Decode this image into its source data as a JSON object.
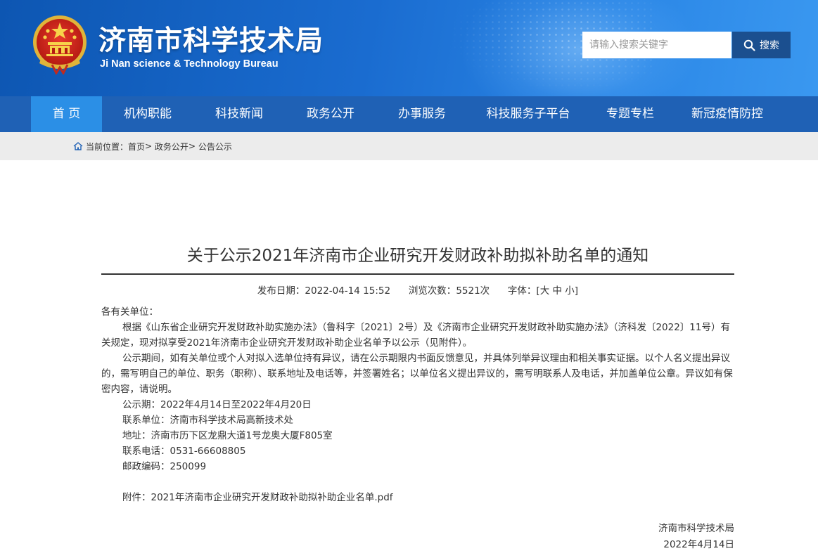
{
  "header": {
    "title": "济南市科学技术局",
    "subtitle": "Ji Nan science & Technology Bureau",
    "search": {
      "placeholder": "请输入搜索关键字",
      "button_label": "搜索"
    }
  },
  "nav": {
    "items": [
      "首 页",
      "机构职能",
      "科技新闻",
      "政务公开",
      "办事服务",
      "科技服务子平台",
      "专题专栏",
      "新冠疫情防控"
    ],
    "active_index": 0
  },
  "breadcrumb": {
    "prefix": "当前位置：",
    "items": [
      "首页",
      "政务公开",
      "公告公示"
    ],
    "separator": ">"
  },
  "article": {
    "title": "关于公示2021年济南市企业研究开发财政补助拟补助名单的通知",
    "meta": {
      "date_label": "发布日期：",
      "date": "2022-04-14 15:52",
      "views_label": "浏览次数：",
      "views": "5521次",
      "fontsize_label": "字体：",
      "fontsize_open": "[",
      "fontsize_large": "大",
      "fontsize_medium": "中",
      "fontsize_small": "小",
      "fontsize_close": "]"
    },
    "salutation": "各有关单位：",
    "paragraphs": [
      "根据《山东省企业研究开发财政补助实施办法》（鲁科字〔2021〕2号）及《济南市企业研究开发财政补助实施办法》（济科发〔2022〕11号）有关规定，现对拟享受2021年济南市企业研究开发财政补助企业名单予以公示（见附件）。",
      "公示期间，如有关单位或个人对拟入选单位持有异议，请在公示期限内书面反馈意见，并具体列举异议理由和相关事实证据。以个人名义提出异议的，需写明自己的单位、职务（职称）、联系地址及电话等，并签署姓名；以单位名义提出异议的，需写明联系人及电话，并加盖单位公章。异议如有保密内容，请说明。",
      "公示期：2022年4月14日至2022年4月20日",
      "联系单位：济南市科学技术局高新技术处",
      "地址：济南市历下区龙鼎大道1号龙奥大厦F805室",
      "联系电话：0531-66608805",
      "邮政编码：250099"
    ],
    "attachment": {
      "label": "附件：",
      "file": "2021年济南市企业研究开发财政补助拟补助企业名单.pdf"
    },
    "signature": {
      "org": "济南市科学技术局",
      "date": "2022年4月14日"
    }
  },
  "colors": {
    "header_blue": "#1a6cd0",
    "nav_blue": "#1f61b5",
    "nav_active": "#2b8fe6",
    "search_button": "#1b4f8f",
    "breadcrumb_bg": "#ececec"
  }
}
